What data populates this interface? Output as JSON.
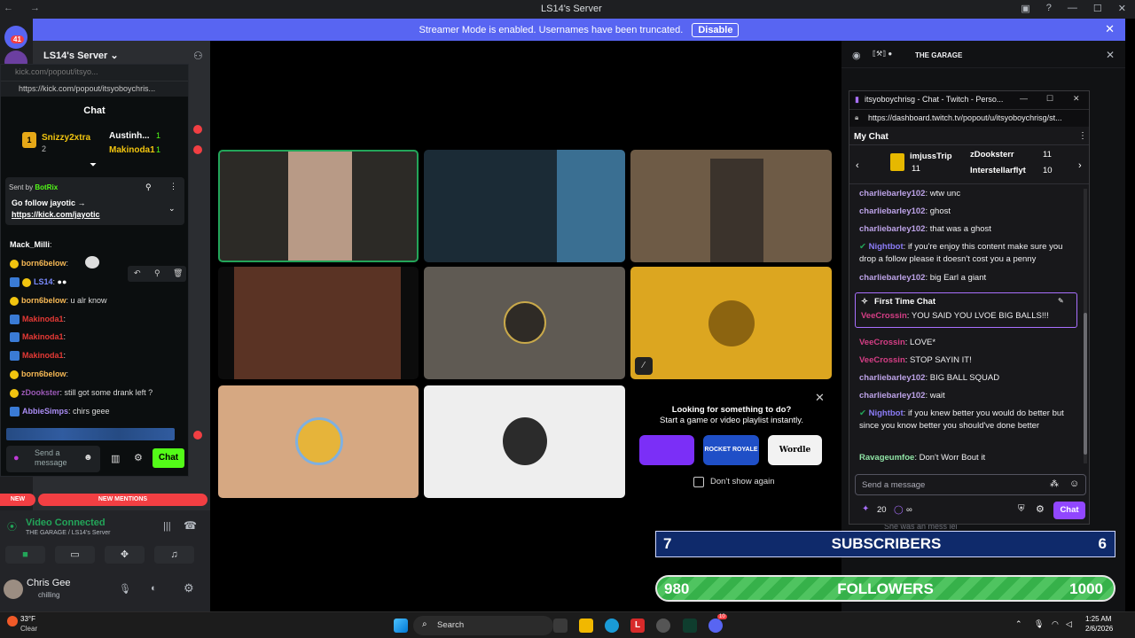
{
  "window": {
    "title": "LS14's Server"
  },
  "streamer_bar": {
    "text": "Streamer Mode is enabled. Usernames have been truncated.",
    "disable_label": "Disable"
  },
  "rail": {
    "mention_badge": "41"
  },
  "server": {
    "name": "LS14's Server"
  },
  "kick": {
    "tab_title": "kick.com/popout/itsyo...",
    "url": "https://kick.com/popout/itsyoboychris...",
    "chat_title": "Chat",
    "leaders": [
      {
        "name": "Snizzy2xtra",
        "count": "2"
      },
      {
        "name": "Austinh...",
        "count": "1"
      },
      {
        "name": "Makinoda1",
        "count": "1"
      }
    ],
    "pinned_sender_prefix": "Sent by",
    "pinned_sender": "BotRix",
    "pinned_text": "Go follow jayotic →",
    "pinned_link": "https://kick.com/jayotic",
    "messages": [
      {
        "user": "Mack_Milli",
        "text": ""
      },
      {
        "user": "born6below",
        "text": ""
      },
      {
        "user": "LS14",
        "text": ""
      },
      {
        "user": "born6below",
        "text": "u alr know"
      },
      {
        "user": "Makinoda1",
        "text": ""
      },
      {
        "user": "Makinoda1",
        "text": ""
      },
      {
        "user": "Makinoda1",
        "text": ""
      },
      {
        "user": "born6below",
        "text": ""
      },
      {
        "user": "zDookster",
        "text": "still got some drank left ?"
      },
      {
        "user": "AbbieSimps",
        "text": "chirs geee"
      }
    ],
    "input_placeholder": "Send a message",
    "send_label": "Chat"
  },
  "sidebar": {
    "new_label": "NEW",
    "mentions_label": "NEW MENTIONS",
    "voice_status": "Video Connected",
    "voice_channel": "THE GARAGE / LS14's Server",
    "user_name": "Chris Gee",
    "user_status": "chilling"
  },
  "call": {
    "suggestion_title": "Looking for something to do?",
    "suggestion_sub": "Start a game or video playlist instantly.",
    "dont_show": "Don't show again",
    "apps": [
      "ROCKET ROYALE",
      "Wordle"
    ]
  },
  "right": {
    "channel_title": "THE GARAGE",
    "partial_text": "She was an mess lel"
  },
  "twitch": {
    "window_title": "itsyoboychrisg - Chat - Twitch - Perso...",
    "url": "https://dashboard.twitch.tv/popout/u/itsyoboychrisg/st...",
    "header": "My Chat",
    "leaders": [
      {
        "name": "imjussTrip",
        "count": "11"
      },
      {
        "name": "zDooksterr",
        "count": "11"
      },
      {
        "name": "Interstellarflyt",
        "count": "10"
      }
    ],
    "messages": [
      {
        "user": "charliebarley102",
        "text": "wtw unc"
      },
      {
        "user": "charliebarley102",
        "text": "ghost"
      },
      {
        "user": "charliebarley102",
        "text": "that was a ghost"
      },
      {
        "user": "Nightbot",
        "text": "if you're enjoy this content make sure you drop a follow please it doesn't cost you a penny"
      },
      {
        "user": "charliebarley102",
        "text": "big Earl a giant"
      }
    ],
    "first_time_label": "First Time Chat",
    "first_time_user": "VeeCrossin",
    "first_time_text": "YOU SAID YOU LVOE BIG BALLS!!!",
    "messages2": [
      {
        "user": "VeeCrossin",
        "text": "LOVE*"
      },
      {
        "user": "VeeCrossin",
        "text": "STOP SAYIN IT!"
      },
      {
        "user": "charliebarley102",
        "text": "BIG BALL SQUAD"
      },
      {
        "user": "charliebarley102",
        "text": "wait"
      },
      {
        "user": "Nightbot",
        "text": "if you knew better you would do better but since you know better you should've done better"
      },
      {
        "user": "Ravageumfoe",
        "text": "Don't Worr Bout it"
      }
    ],
    "input_placeholder": "Send a message",
    "points": "20",
    "infinity": "∞",
    "send_label": "Chat"
  },
  "goals": {
    "subs": {
      "current": "7",
      "label": "SUBSCRIBERS",
      "target": "6"
    },
    "followers": {
      "current": "980",
      "label": "FOLLOWERS",
      "target": "1000"
    }
  },
  "taskbar": {
    "weather_temp": "33°F",
    "weather_desc": "Clear",
    "search_label": "Search",
    "time": "1:25 AM",
    "date": "2/6/2026",
    "discord_badge": "10"
  }
}
